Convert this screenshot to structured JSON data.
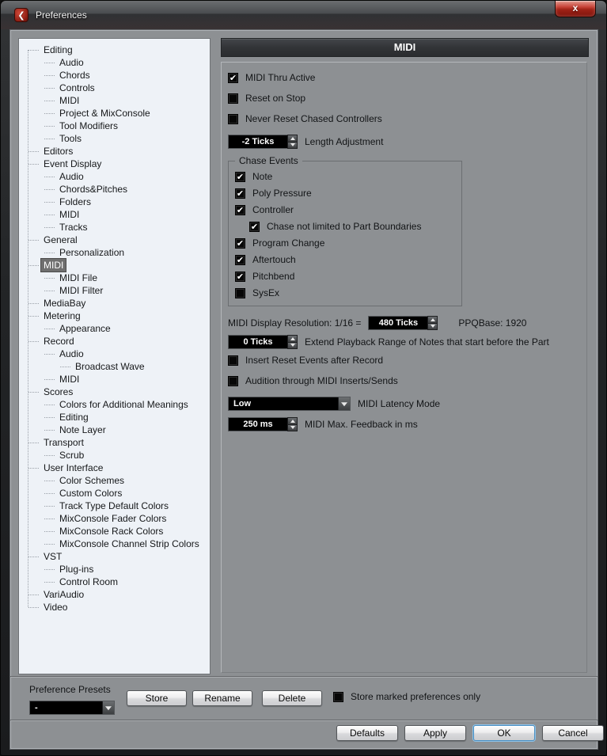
{
  "window": {
    "title": "Preferences",
    "close_glyph": "x",
    "logo_glyph": "❮"
  },
  "sidebar": {
    "items": [
      {
        "label": "Editing",
        "level": 0
      },
      {
        "label": "Audio",
        "level": 1
      },
      {
        "label": "Chords",
        "level": 1
      },
      {
        "label": "Controls",
        "level": 1
      },
      {
        "label": "MIDI",
        "level": 1
      },
      {
        "label": "Project & MixConsole",
        "level": 1
      },
      {
        "label": "Tool Modifiers",
        "level": 1
      },
      {
        "label": "Tools",
        "level": 1
      },
      {
        "label": "Editors",
        "level": 0
      },
      {
        "label": "Event Display",
        "level": 0
      },
      {
        "label": "Audio",
        "level": 1
      },
      {
        "label": "Chords&Pitches",
        "level": 1
      },
      {
        "label": "Folders",
        "level": 1
      },
      {
        "label": "MIDI",
        "level": 1
      },
      {
        "label": "Tracks",
        "level": 1
      },
      {
        "label": "General",
        "level": 0
      },
      {
        "label": "Personalization",
        "level": 1
      },
      {
        "label": "MIDI",
        "level": 0,
        "selected": true
      },
      {
        "label": "MIDI File",
        "level": 1
      },
      {
        "label": "MIDI Filter",
        "level": 1
      },
      {
        "label": "MediaBay",
        "level": 0
      },
      {
        "label": "Metering",
        "level": 0
      },
      {
        "label": "Appearance",
        "level": 1
      },
      {
        "label": "Record",
        "level": 0
      },
      {
        "label": "Audio",
        "level": 1
      },
      {
        "label": "Broadcast Wave",
        "level": 2
      },
      {
        "label": "MIDI",
        "level": 1
      },
      {
        "label": "Scores",
        "level": 0
      },
      {
        "label": "Colors for Additional Meanings",
        "level": 1
      },
      {
        "label": "Editing",
        "level": 1
      },
      {
        "label": "Note Layer",
        "level": 1
      },
      {
        "label": "Transport",
        "level": 0
      },
      {
        "label": "Scrub",
        "level": 1
      },
      {
        "label": "User Interface",
        "level": 0
      },
      {
        "label": "Color Schemes",
        "level": 1
      },
      {
        "label": "Custom Colors",
        "level": 1
      },
      {
        "label": "Track Type Default Colors",
        "level": 1
      },
      {
        "label": "MixConsole Fader Colors",
        "level": 1
      },
      {
        "label": "MixConsole Rack Colors",
        "level": 1
      },
      {
        "label": "MixConsole Channel Strip Colors",
        "level": 1
      },
      {
        "label": "VST",
        "level": 0
      },
      {
        "label": "Plug-ins",
        "level": 1
      },
      {
        "label": "Control Room",
        "level": 1
      },
      {
        "label": "VariAudio",
        "level": 0
      },
      {
        "label": "Video",
        "level": 0
      }
    ]
  },
  "panel": {
    "title": "MIDI",
    "rows": [
      {
        "type": "checkbox",
        "checked": true,
        "label": "MIDI Thru Active"
      },
      {
        "type": "checkbox",
        "checked": false,
        "label": "Reset on Stop"
      },
      {
        "type": "checkbox",
        "checked": false,
        "label": "Never Reset Chased Controllers"
      },
      {
        "type": "spinner",
        "value": "-2 Ticks",
        "label": "Length Adjustment"
      },
      {
        "type": "group",
        "legend": "Chase Events",
        "items": [
          {
            "checked": true,
            "label": "Note"
          },
          {
            "checked": true,
            "label": "Poly Pressure"
          },
          {
            "checked": true,
            "label": "Controller"
          },
          {
            "checked": true,
            "label": "Chase not limited to Part Boundaries",
            "indent": true
          },
          {
            "checked": true,
            "label": "Program Change"
          },
          {
            "checked": true,
            "label": "Aftertouch"
          },
          {
            "checked": true,
            "label": "Pitchbend"
          },
          {
            "checked": false,
            "label": "SysEx"
          }
        ]
      },
      {
        "type": "resolution",
        "prefix": "MIDI Display Resolution: 1/16 =",
        "value": "480 Ticks",
        "suffix": "PPQBase: 1920"
      },
      {
        "type": "spinner",
        "value": "0 Ticks",
        "label": "Extend Playback Range of Notes that start before the Part"
      },
      {
        "type": "checkbox",
        "checked": false,
        "label": "Insert Reset Events after Record"
      },
      {
        "type": "checkbox",
        "checked": false,
        "label": "Audition through MIDI Inserts/Sends"
      },
      {
        "type": "dropdown",
        "value": "Low",
        "label": "MIDI Latency Mode"
      },
      {
        "type": "spinner",
        "value": "250 ms",
        "label": "MIDI Max. Feedback in ms"
      }
    ]
  },
  "presets": {
    "label": "Preference Presets",
    "value": "-",
    "buttons": [
      "Store",
      "Rename",
      "Delete"
    ],
    "checkbox": {
      "label": "Store marked preferences only",
      "checked": false
    }
  },
  "footer": {
    "buttons": [
      {
        "label": "Defaults"
      },
      {
        "label": "Apply"
      },
      {
        "label": "OK",
        "default": true
      },
      {
        "label": "Cancel"
      }
    ]
  },
  "colors": {
    "dialog_bg": "#8d9093",
    "sidebar_bg": "#eef2f7",
    "header_bg": "#37393c",
    "field_bg": "#000000",
    "accent_red": "#a02317",
    "selected_bg": "#6f6f6f",
    "focus_blue": "#8fc3e8"
  }
}
